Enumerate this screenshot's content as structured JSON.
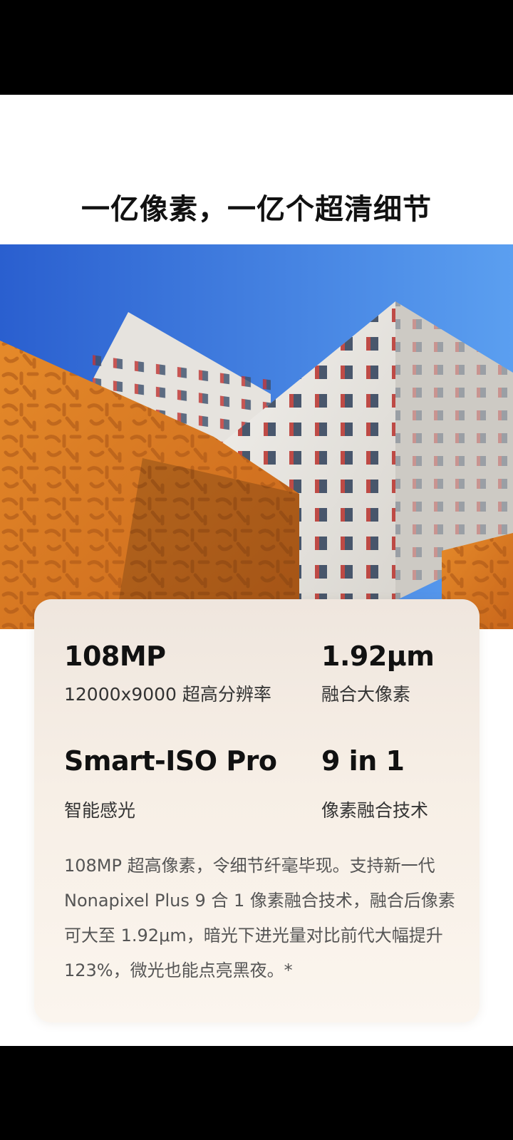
{
  "headline": "一亿像素，一亿个超清细节",
  "photo": {
    "icon": "building-photo",
    "colors": {
      "sky": "#2f6fd8",
      "orange_wall": "#e08a2a",
      "white_building": "#e9e7e2"
    }
  },
  "specs": [
    {
      "value": "108MP",
      "label": "12000x9000 超高分辨率"
    },
    {
      "value": "1.92μm",
      "label": "融合大像素"
    },
    {
      "value": "Smart-ISO Pro",
      "label": "智能感光"
    },
    {
      "value": "9 in 1",
      "label": "像素融合技术"
    }
  ],
  "description": "108MP 超高像素，令细节纤毫毕现。支持新一代 Nonapixel Plus 9 合 1 像素融合技术，融合后像素可大至 1.92μm，暗光下进光量对比前代大幅提升 123%，微光也能点亮黑夜。*"
}
